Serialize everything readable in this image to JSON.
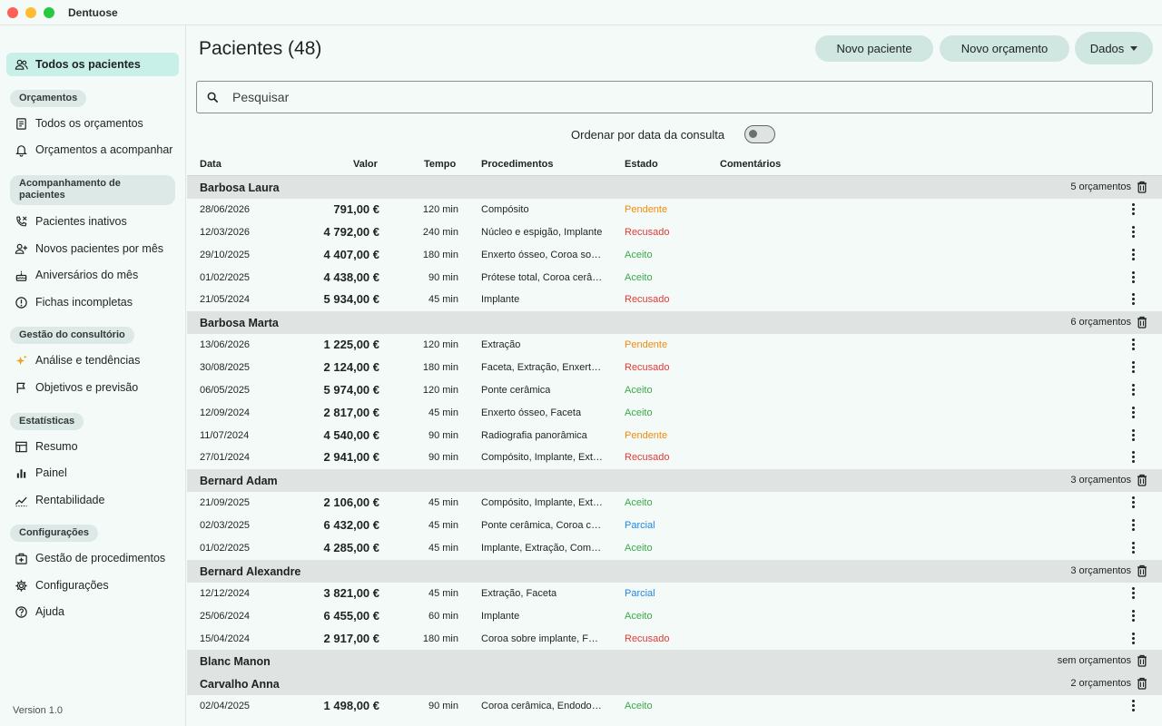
{
  "app": {
    "title": "Dentuose"
  },
  "colors": {
    "accent": "#c8efe8",
    "pendente": "#f08c0a",
    "recusado": "#e53935",
    "aceito": "#3aaa4a",
    "parcial": "#1e88e5"
  },
  "sidebar": {
    "all_patients": "Todos os pacientes",
    "sections": [
      {
        "label": "Orçamentos",
        "items": [
          {
            "label": "Todos os orçamentos",
            "icon": "receipt-icon"
          },
          {
            "label": "Orçamentos a acompanhar",
            "icon": "bell-icon"
          }
        ]
      },
      {
        "label": "Acompanhamento de pacientes",
        "items": [
          {
            "label": "Pacientes inativos",
            "icon": "phone-icon"
          },
          {
            "label": "Novos pacientes por mês",
            "icon": "person-add-icon"
          },
          {
            "label": "Aniversários do mês",
            "icon": "cake-icon"
          },
          {
            "label": "Fichas incompletas",
            "icon": "alert-circle-icon"
          }
        ]
      },
      {
        "label": "Gestão do consultório",
        "items": [
          {
            "label": "Análise e tendências",
            "icon": "sparkle-icon"
          },
          {
            "label": "Objetivos e previsão",
            "icon": "flag-icon"
          }
        ]
      },
      {
        "label": "Estatísticas",
        "items": [
          {
            "label": "Resumo",
            "icon": "table-icon"
          },
          {
            "label": "Painel",
            "icon": "bar-chart-icon"
          },
          {
            "label": "Rentabilidade",
            "icon": "trend-icon"
          }
        ]
      },
      {
        "label": "Configurações",
        "items": [
          {
            "label": "Gestão de procedimentos",
            "icon": "medical-box-icon"
          },
          {
            "label": "Configurações",
            "icon": "gear-icon"
          },
          {
            "label": "Ajuda",
            "icon": "help-icon"
          }
        ]
      }
    ],
    "version": "Version 1.0"
  },
  "header": {
    "title": "Pacientes (48)",
    "new_patient": "Novo paciente",
    "new_quote": "Novo orçamento",
    "data_menu": "Dados"
  },
  "search": {
    "placeholder": "Pesquisar"
  },
  "sort": {
    "label": "Ordenar por data da consulta",
    "enabled": false
  },
  "table": {
    "columns": {
      "date": "Data",
      "value": "Valor",
      "time": "Tempo",
      "procedures": "Procedimentos",
      "state": "Estado",
      "comments": "Comentários"
    },
    "groups": [
      {
        "name": "Barbosa Laura",
        "count": "5 orçamentos",
        "rows": [
          {
            "date": "28/06/2026",
            "value": "791,00 €",
            "time": "120 min",
            "procedures": "Compósito",
            "state": "Pendente"
          },
          {
            "date": "12/03/2026",
            "value": "4 792,00 €",
            "time": "240 min",
            "procedures": "Núcleo e espigão, Implante",
            "state": "Recusado"
          },
          {
            "date": "29/10/2025",
            "value": "4 407,00 €",
            "time": "180 min",
            "procedures": "Enxerto ósseo, Coroa sobre implante",
            "state": "Aceito"
          },
          {
            "date": "01/02/2025",
            "value": "4 438,00 €",
            "time": "90 min",
            "procedures": "Prótese total, Coroa cerâmica",
            "state": "Aceito"
          },
          {
            "date": "21/05/2024",
            "value": "5 934,00 €",
            "time": "45 min",
            "procedures": "Implante",
            "state": "Recusado"
          }
        ]
      },
      {
        "name": "Barbosa Marta",
        "count": "6 orçamentos",
        "rows": [
          {
            "date": "13/06/2026",
            "value": "1 225,00 €",
            "time": "120 min",
            "procedures": "Extração",
            "state": "Pendente"
          },
          {
            "date": "30/08/2025",
            "value": "2 124,00 €",
            "time": "180 min",
            "procedures": "Faceta, Extração, Enxerto ósseo",
            "state": "Recusado"
          },
          {
            "date": "06/05/2025",
            "value": "5 974,00 €",
            "time": "120 min",
            "procedures": "Ponte cerâmica",
            "state": "Aceito"
          },
          {
            "date": "12/09/2024",
            "value": "2 817,00 €",
            "time": "45 min",
            "procedures": "Enxerto ósseo, Faceta",
            "state": "Aceito"
          },
          {
            "date": "11/07/2024",
            "value": "4 540,00 €",
            "time": "90 min",
            "procedures": "Radiografia panorâmica",
            "state": "Pendente"
          },
          {
            "date": "27/01/2024",
            "value": "2 941,00 €",
            "time": "90 min",
            "procedures": "Compósito, Implante, Extração",
            "state": "Recusado"
          }
        ]
      },
      {
        "name": "Bernard Adam",
        "count": "3 orçamentos",
        "rows": [
          {
            "date": "21/09/2025",
            "value": "2 106,00 €",
            "time": "45 min",
            "procedures": "Compósito, Implante, Extração",
            "state": "Aceito"
          },
          {
            "date": "02/03/2025",
            "value": "6 432,00 €",
            "time": "45 min",
            "procedures": "Ponte cerâmica, Coroa cerâmica",
            "state": "Parcial"
          },
          {
            "date": "01/02/2025",
            "value": "4 285,00 €",
            "time": "45 min",
            "procedures": "Implante, Extração, Compósito",
            "state": "Aceito"
          }
        ]
      },
      {
        "name": "Bernard Alexandre",
        "count": "3 orçamentos",
        "rows": [
          {
            "date": "12/12/2024",
            "value": "3 821,00 €",
            "time": "45 min",
            "procedures": "Extração, Faceta",
            "state": "Parcial"
          },
          {
            "date": "25/06/2024",
            "value": "6 455,00 €",
            "time": "60 min",
            "procedures": "Implante",
            "state": "Aceito"
          },
          {
            "date": "15/04/2024",
            "value": "2 917,00 €",
            "time": "180 min",
            "procedures": "Coroa sobre implante, Faceta",
            "state": "Recusado"
          }
        ]
      },
      {
        "name": "Blanc Manon",
        "count": "sem orçamentos",
        "rows": []
      },
      {
        "name": "Carvalho Anna",
        "count": "2 orçamentos",
        "rows": [
          {
            "date": "02/04/2025",
            "value": "1 498,00 €",
            "time": "90 min",
            "procedures": "Coroa cerâmica, Endodontia",
            "state": "Aceito"
          }
        ]
      }
    ]
  }
}
